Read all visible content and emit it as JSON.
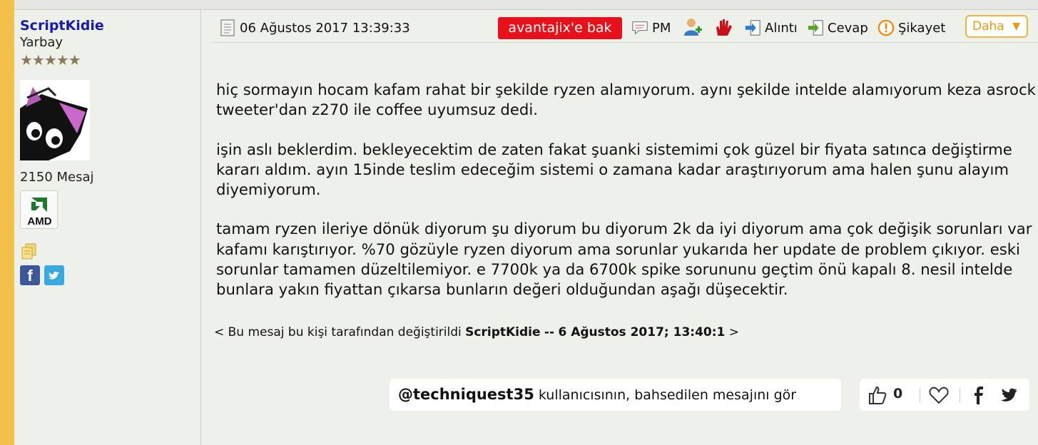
{
  "user": {
    "name": "ScriptKidie",
    "rank": "Yarbay",
    "stars": "★★★★★",
    "message_count": "2150 Mesaj",
    "badge_text": "AMD"
  },
  "header": {
    "date": "06 Ağustos 2017 13:39:33",
    "avantaj_label": "avantajix'e bak",
    "pm_label": "PM",
    "quote_label": "Alıntı",
    "reply_label": "Cevap",
    "report_label": "Şikayet",
    "more_label": "Daha"
  },
  "post": {
    "paragraphs": [
      "hiç sormayın hocam kafam rahat bir şekilde ryzen alamıyorum. aynı şekilde intelde alamıyorum keza asrock tweeter'dan z270 ile coffee uyumsuz dedi.",
      "işin aslı beklerdim. bekleyecektim de zaten fakat şuanki sistemimi çok güzel bir fiyata satınca değiştirme kararı aldım. ayın 15inde teslim edeceğim sistemi o zamana kadar araştırıyorum ama halen şunu alayım diyemiyorum.",
      "tamam ryzen ileriye dönük diyorum şu diyorum bu diyorum 2k da iyi diyorum ama çok değişik sorunları var kafamı karıştırıyor. %70 gözüyle ryzen diyorum ama sorunlar yukarıda her update de problem çıkıyor. eski sorunlar tamamen düzeltilemiyor. e 7700k ya da 6700k spike sorununu geçtim önü kapalı 8. nesil intelde bunlara yakın fiyattan çıkarsa bunların değeri olduğundan aşağı düşecektir."
    ],
    "edited_prefix": "< Bu mesaj bu kişi tarafından değiştirildi",
    "edited_user": "ScriptKidie",
    "edited_sep": "--",
    "edited_date": "6 Ağustos 2017; 13:40:1",
    "edited_suffix": ">"
  },
  "footer": {
    "mention_user": "@techniquest35",
    "mention_text": "kullanıcısının, bahsedilen mesajını gör",
    "like_count": "0"
  },
  "colors": {
    "accent_stripe": "#f5c04a",
    "username": "#1a1aa8",
    "avantaj_bg": "#e8101a",
    "daha_border": "#f0b440"
  }
}
